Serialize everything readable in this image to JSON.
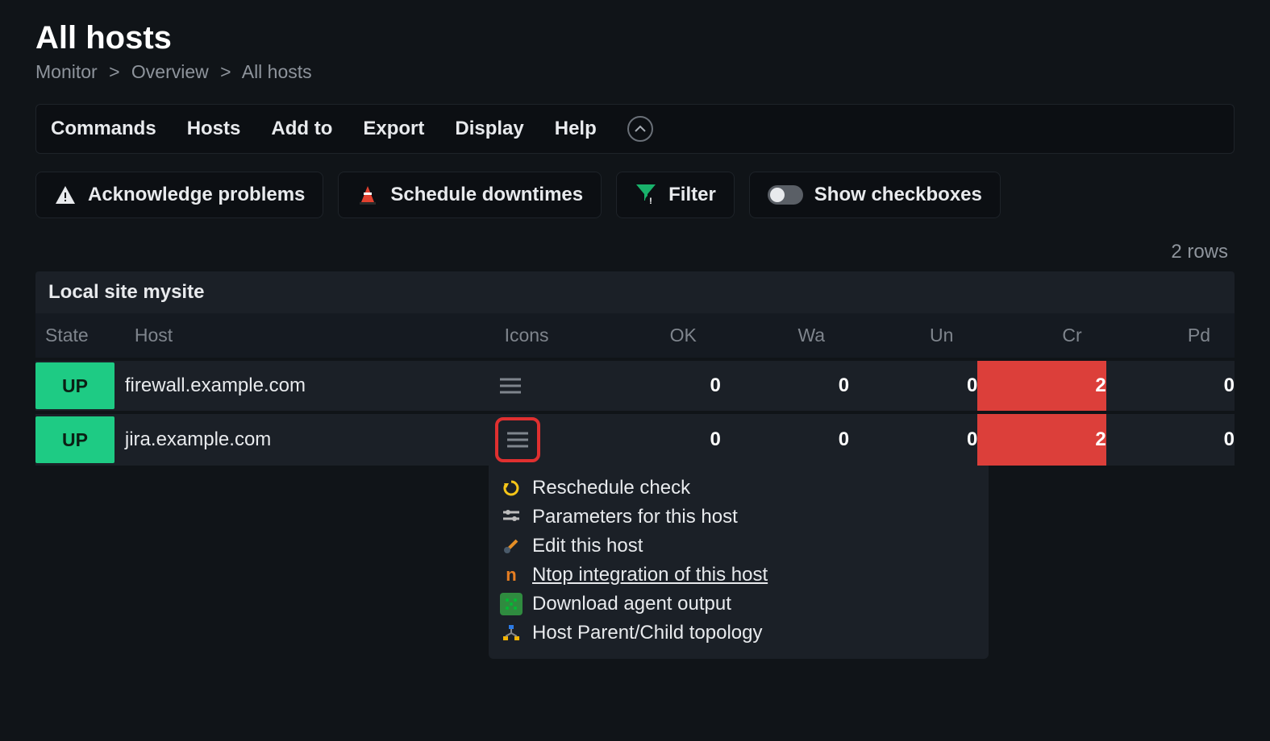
{
  "page": {
    "title": "All hosts",
    "row_count": "2 rows"
  },
  "breadcrumb": {
    "items": [
      "Monitor",
      "Overview",
      "All hosts"
    ],
    "sep": ">"
  },
  "menubar": {
    "commands": "Commands",
    "hosts": "Hosts",
    "addto": "Add to",
    "export": "Export",
    "display": "Display",
    "help": "Help"
  },
  "actions": {
    "ack": "Acknowledge problems",
    "sched": "Schedule downtimes",
    "filter": "Filter",
    "checkboxes": "Show checkboxes"
  },
  "panel": {
    "header": "Local site mysite",
    "columns": {
      "state": "State",
      "host": "Host",
      "icons": "Icons",
      "ok": "OK",
      "wa": "Wa",
      "un": "Un",
      "cr": "Cr",
      "pd": "Pd"
    },
    "rows": [
      {
        "state": "UP",
        "host": "firewall.example.com",
        "ok": "0",
        "wa": "0",
        "un": "0",
        "cr": "2",
        "pd": "0",
        "active": false
      },
      {
        "state": "UP",
        "host": "jira.example.com",
        "ok": "0",
        "wa": "0",
        "un": "0",
        "cr": "2",
        "pd": "0",
        "active": true
      }
    ]
  },
  "context_menu": {
    "items": [
      {
        "icon": "reschedule-icon",
        "label": "Reschedule check",
        "underlined": false
      },
      {
        "icon": "params-icon",
        "label": "Parameters for this host",
        "underlined": false
      },
      {
        "icon": "edit-icon",
        "label": "Edit this host",
        "underlined": false
      },
      {
        "icon": "ntop-icon",
        "label": "Ntop integration of this host",
        "underlined": true
      },
      {
        "icon": "download-icon",
        "label": "Download agent output",
        "underlined": false
      },
      {
        "icon": "topology-icon",
        "label": "Host Parent/Child topology",
        "underlined": false
      }
    ]
  }
}
